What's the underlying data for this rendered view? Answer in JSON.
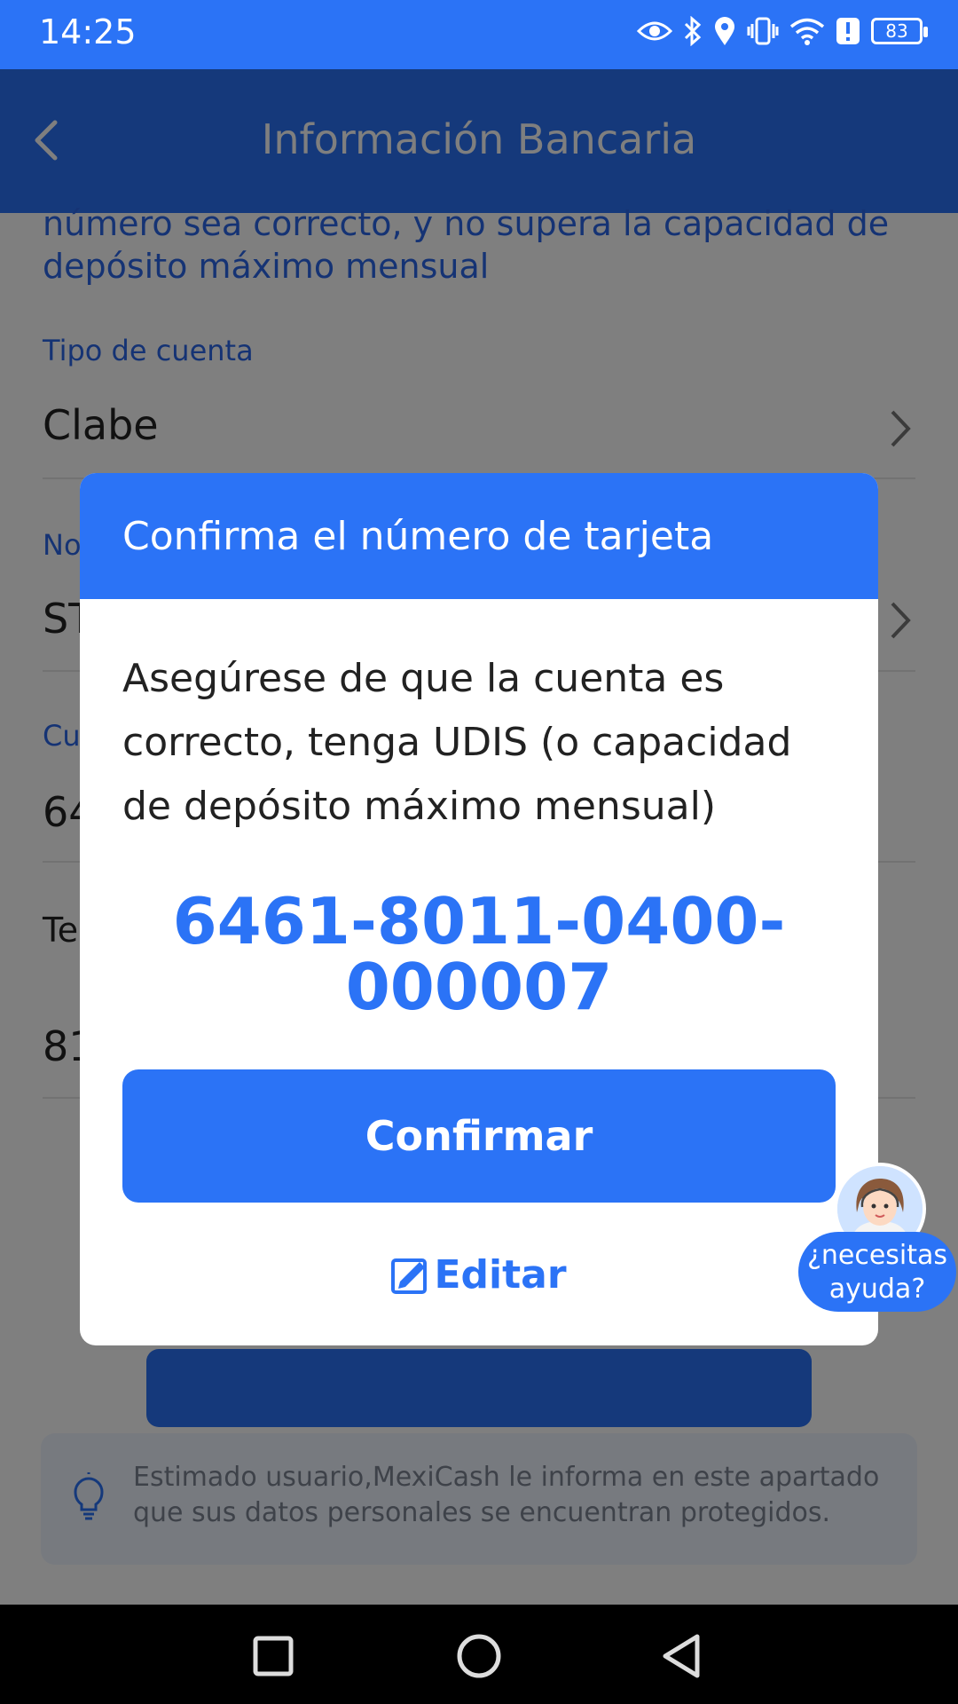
{
  "status_bar": {
    "time": "14:25",
    "battery": "83"
  },
  "header": {
    "title": "Información Bancaria"
  },
  "page": {
    "notice": "número sea correcto, y no supera la capacidad de depósito máximo mensual",
    "fields": [
      {
        "label": "Tipo de cuenta",
        "value": "Clabe"
      },
      {
        "label": "No",
        "value": "ST"
      },
      {
        "label": "Cu",
        "value": "64"
      },
      {
        "label": "Te",
        "value": "81"
      }
    ],
    "privacy_note": "Estimado usuario,MexiCash le informa en este apartado que sus datos personales se encuentran protegidos."
  },
  "dialog": {
    "title": "Confirma el número de tarjeta",
    "message": "Asegúrese de que la cuenta es correcto, tenga UDIS (o capacidad de depósito máximo mensual)",
    "number_line1": "6461-8011-0400-",
    "number_line2": "000007",
    "confirm_label": "Confirmar",
    "edit_label": "Editar"
  },
  "help": {
    "label_line1": "¿necesitas",
    "label_line2": "ayuda?"
  },
  "colors": {
    "primary": "#2b73f6",
    "overlay": "rgba(0,0,0,0.5)"
  },
  "icons": [
    "back-arrow-icon",
    "chevron-right-icon",
    "lightbulb-icon",
    "edit-icon",
    "nav-recents-icon",
    "nav-home-icon",
    "nav-back-icon"
  ]
}
